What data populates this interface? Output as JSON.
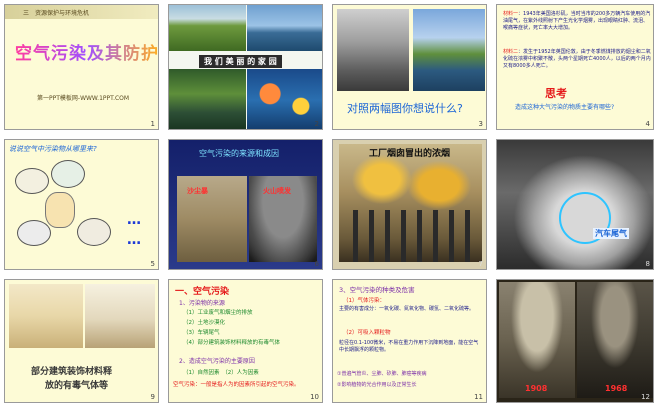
{
  "slides": [
    {
      "num": "1",
      "header": "三　资源保护与环境危机",
      "title": "空气污染及其防护",
      "footer": "第一PPT模板网-WWW.1PPT.COM"
    },
    {
      "num": "2",
      "caption": "我 们 美 丽 的 家 园"
    },
    {
      "num": "3",
      "question": "对照两幅图你想说什么?"
    },
    {
      "num": "4",
      "text1_tag": "材料一",
      "text1": "：1943年美国洛杉矶，当时当市的200多万辆汽车使用的汽油尾气，在紫外线照射下产生光化学烟雾，出现眼睛红肿、流泪、喉痛等症状，死亡率大大增加。",
      "text2_tag": "材料二",
      "text2": "：发生于1952年英国伦敦，由于冬季燃煤排放的烟尘和二氧化硫在浓雾中积聚不散，头两个星期死亡4000人，以后的两个月内又有8000多人死亡。",
      "think": "思考",
      "think_q": "造成这种大气污染的物质主要有哪些?"
    },
    {
      "num": "5",
      "question": "说说空气中污染物从哪里来?",
      "dots": "…",
      "dots2": "…"
    },
    {
      "num": "6",
      "title": "空气污染的来源和成因",
      "label1": "沙尘暴",
      "label2": "火山喷发"
    },
    {
      "num": "7",
      "title": "工厂烟囱冒出的浓烟"
    },
    {
      "num": "8",
      "label": "汽车尾气"
    },
    {
      "num": "9",
      "caption1": "部分建筑装饰材料释",
      "caption2": "放的有毒气体等"
    },
    {
      "num": "10",
      "heading": "一、空气污染",
      "sub1": "1、污染物的来源",
      "items": [
        "（1）工业废气和烟尘的排放",
        "（2）土地沙漠化",
        "（3）车辆尾气",
        "（4）部分建筑装饰材料释放的有毒气体"
      ],
      "sub2": "2、造成空气污染的主要原因",
      "causes": "（1）自然因素　（2）人为因素",
      "note": "空气污染：一般是指人为的因素所引起的空气污染。"
    },
    {
      "num": "11",
      "heading": "3、空气污染的种类及危害",
      "item1": "（1）气体污染：",
      "item1_text": "主要的有害成分：一氧化碳、氮氧化物、碳氢、二氧化硫等。",
      "item2": "（2）可吸入颗粒物",
      "item2_text": "粒径在0.1-100微米，不易在重力作用下沉降到地面，能在空气中长期飘浮的颗粒物。",
      "b1": "①普遍气管炎、尘肺、矽肺、肺癌等疾病",
      "b2": "②影响植物的光合作用以及正常生长"
    },
    {
      "num": "12",
      "year1": "1908",
      "year2": "1968"
    }
  ],
  "colors": {
    "slide_bg": "#fffde6",
    "border": "#9a9a9a",
    "title_blue": "#1d66d6",
    "red": "#e51b1b",
    "green": "#1e8a2e",
    "purple": "#7b2ea8"
  }
}
